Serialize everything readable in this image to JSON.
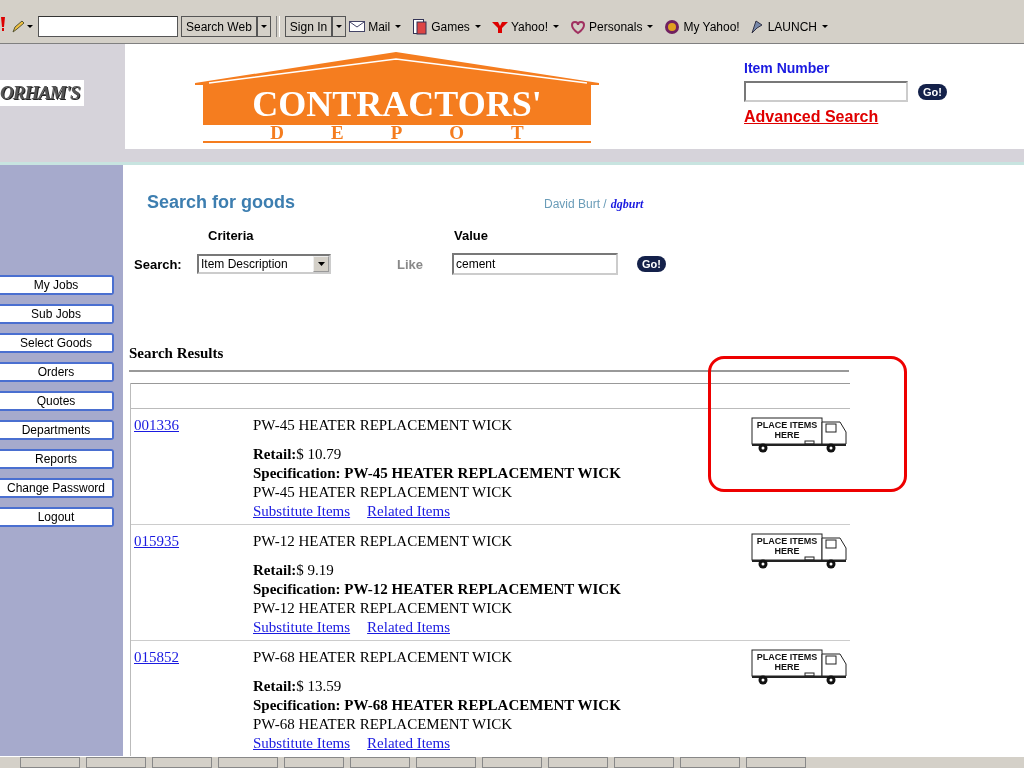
{
  "toolbar": {
    "search_button": "Search Web",
    "sign_in": "Sign In",
    "links": [
      {
        "label": "Mail",
        "has_menu": true
      },
      {
        "label": "Games",
        "has_menu": true
      },
      {
        "label": "Yahoo!",
        "has_menu": true
      },
      {
        "label": "Personals",
        "has_menu": true
      },
      {
        "label": "My Yahoo!",
        "has_menu": false
      },
      {
        "label": "LAUNCH",
        "has_menu": true
      }
    ]
  },
  "header": {
    "brand": "ORHAM'S",
    "logo_top": "CONTRACTORS'",
    "logo_bottom": "DEPOT",
    "item_number_label": "Item Number",
    "go": "Go!",
    "advanced_search": "Advanced Search"
  },
  "sidebar": {
    "items": [
      "My Jobs",
      "Sub Jobs",
      "Select Goods",
      "Orders",
      "Quotes",
      "Departments",
      "Reports",
      "Change Password",
      "Logout"
    ]
  },
  "search": {
    "title": "Search for goods",
    "user_name": "David Burt /",
    "user_id": "dgburt",
    "criteria_label": "Criteria",
    "value_label": "Value",
    "search_label": "Search:",
    "criteria": "Item Description",
    "operator": "Like",
    "value": "cement",
    "go": "Go!"
  },
  "results": {
    "heading": "Search Results",
    "items": [
      {
        "number": "001336",
        "description": "PW-45 HEATER REPLACEMENT WICK",
        "retail": "**Retail:**$  10.79",
        "specification": "Specification: PW-45 HEATER REPLACEMENT WICK",
        "note": "PW-45 HEATER REPLACEMENT WICK",
        "links": [
          "Substitute Items",
          "Related Items"
        ],
        "truck_label": "PLACE ITEMS HERE",
        "highlighted": true
      },
      {
        "number": "015935",
        "description": "PW-12 HEATER REPLACEMENT WICK",
        "retail": "**Retail:**$  9.19",
        "specification": "Specification: PW-12 HEATER REPLACEMENT WICK",
        "note": "PW-12 HEATER REPLACEMENT WICK",
        "links": [
          "Substitute Items",
          "Related Items"
        ],
        "truck_label": "PLACE ITEMS HERE",
        "highlighted": false
      },
      {
        "number": "015852",
        "description": "PW-68 HEATER REPLACEMENT WICK",
        "retail": "**Retail:**$  13.59",
        "specification": "Specification: PW-68 HEATER REPLACEMENT WICK",
        "note": "PW-68 HEATER REPLACEMENT WICK",
        "links": [
          "Substitute Items",
          "Related Items"
        ],
        "truck_label": "PLACE ITEMS HERE",
        "highlighted": false
      }
    ]
  }
}
